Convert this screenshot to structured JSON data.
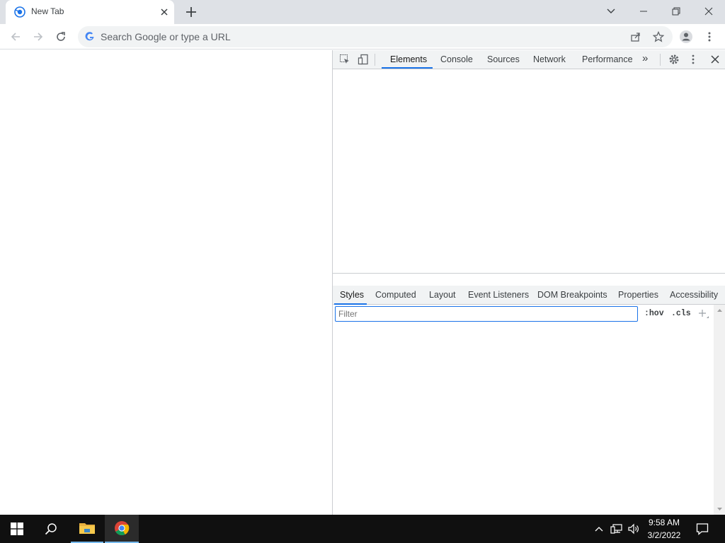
{
  "browser": {
    "tab": {
      "title": "New Tab"
    },
    "omnibox": {
      "placeholder": "Search Google or type a URL"
    },
    "icons": {
      "favicon": "chrome-newtab-icon",
      "close_tab": "close-icon",
      "new_tab": "plus-icon",
      "tab_search": "chevron-down-icon",
      "minimize": "minimize-icon",
      "restore": "restore-icon",
      "close_window": "close-icon",
      "back": "back-arrow-icon",
      "forward": "forward-arrow-icon",
      "reload": "reload-icon",
      "share": "share-icon",
      "bookmark": "star-icon",
      "profile": "profile-icon",
      "menu": "kebab-menu-icon"
    }
  },
  "devtools": {
    "tabs": [
      "Elements",
      "Console",
      "Sources",
      "Network",
      "Performance"
    ],
    "active_tab": "Elements",
    "more_tabs": "»",
    "styles_tabs": [
      "Styles",
      "Computed",
      "Layout",
      "Event Listeners",
      "DOM Breakpoints",
      "Properties",
      "Accessibility"
    ],
    "active_styles_tab": "Styles",
    "filter": {
      "placeholder": "Filter"
    },
    "hov_label": ":hov",
    "cls_label": ".cls",
    "accent_color": "#1a73e8"
  },
  "taskbar": {
    "time": "9:58 AM",
    "date": "3/2/2022",
    "icons": [
      "windows-start-icon",
      "search-icon",
      "file-explorer-icon",
      "chrome-icon",
      "chevron-up-icon",
      "network-icon",
      "volume-icon",
      "notification-icon"
    ]
  }
}
